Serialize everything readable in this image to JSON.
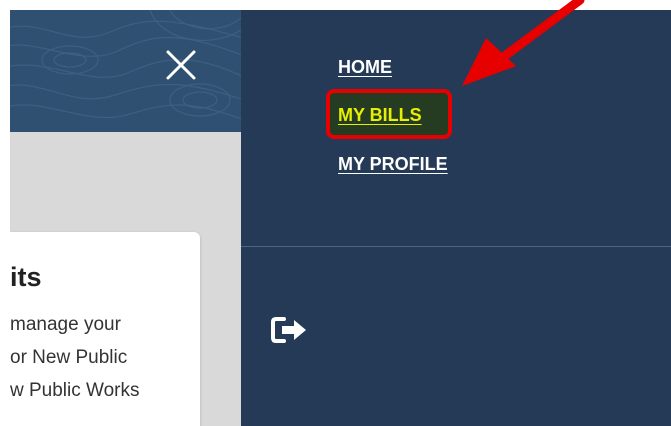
{
  "close_button": {
    "icon": "close-icon",
    "color": "#ffffff"
  },
  "card": {
    "title": "its",
    "lines": [
      "manage your",
      "or New Public",
      "w Public Works"
    ]
  },
  "nav": {
    "items": [
      {
        "label": "HOME",
        "active": false
      },
      {
        "label": "MY BILLS",
        "active": true
      },
      {
        "label": "MY PROFILE",
        "active": false
      }
    ],
    "active_color": "#e6f000",
    "link_color": "#ffffff"
  },
  "logout": {
    "icon": "sign-out-icon"
  },
  "annotation": {
    "highlight_color": "#e60000",
    "arrow_color": "#e60000"
  },
  "colors": {
    "left_header": "#2f5071",
    "left_pane": "#d9d9d9",
    "right_pane": "#243a56"
  }
}
